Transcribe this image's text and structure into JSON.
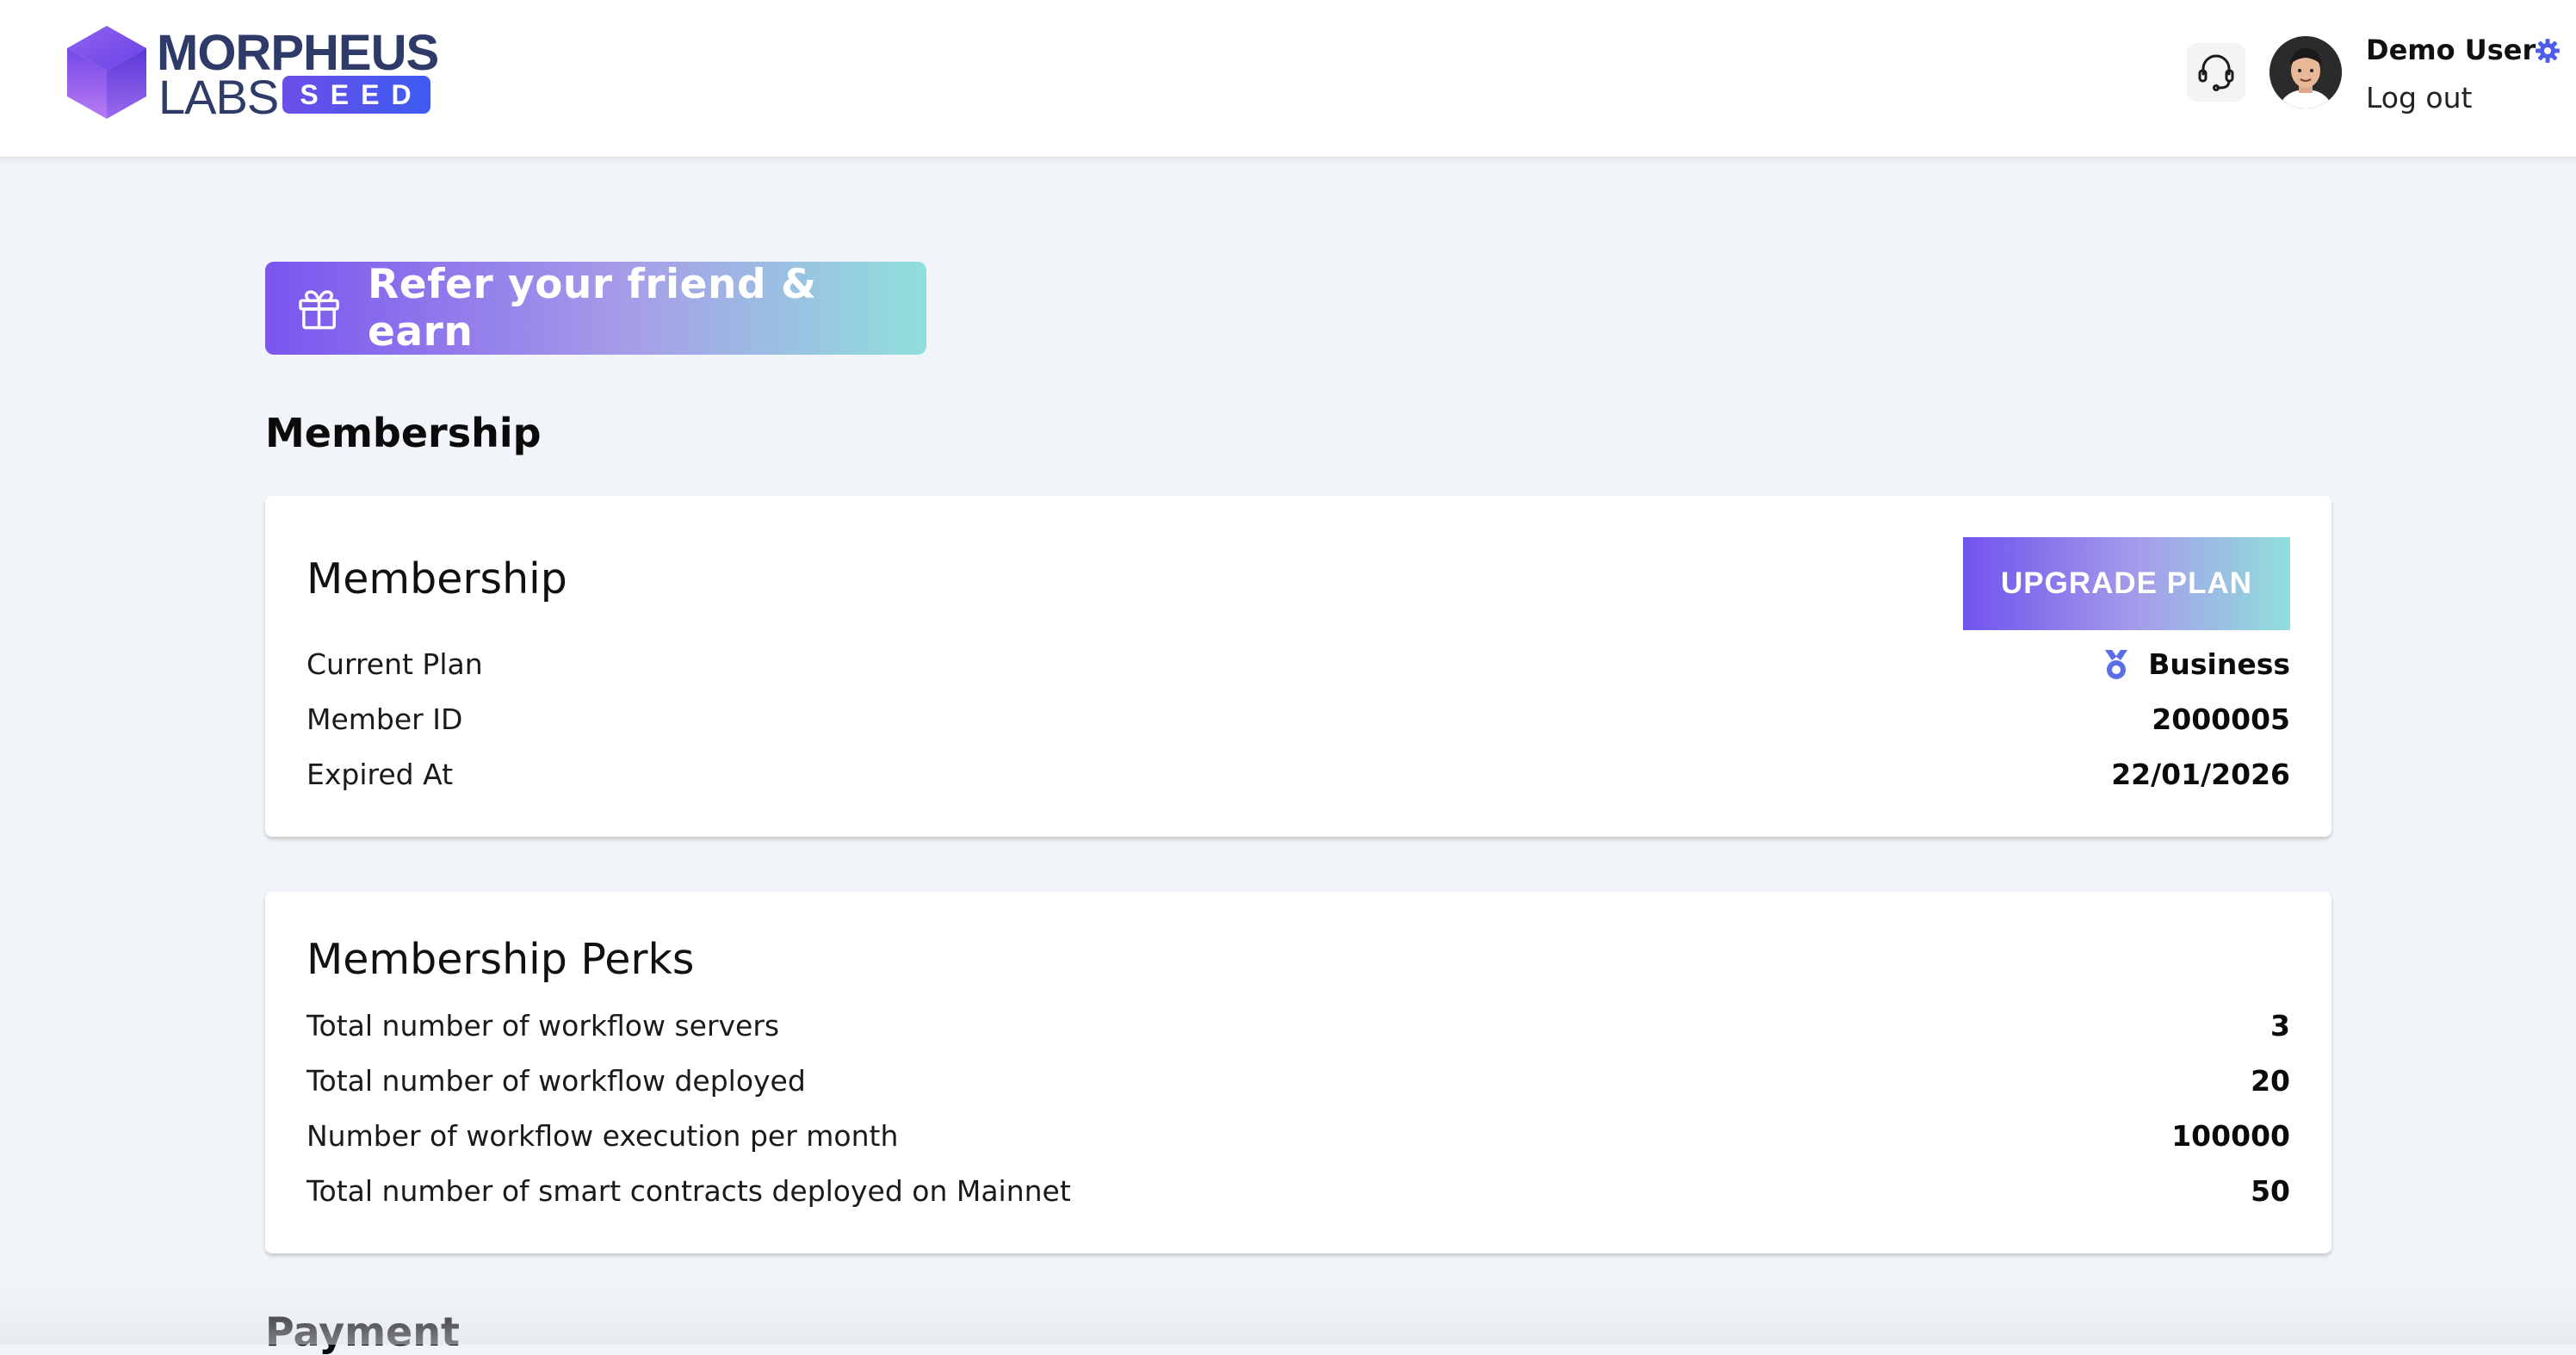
{
  "brand": {
    "word1": "MORPHEUS",
    "word2": "LABS",
    "badge": "SEED",
    "primary_color": "#2e3a67",
    "accent_color": "#6c4fe8"
  },
  "header": {
    "support_icon": "headset-icon",
    "user_name": "Demo User",
    "settings_icon": "gear-icon",
    "logout_label": "Log out"
  },
  "referral": {
    "icon": "gift-icon",
    "label": "Refer your friend & earn"
  },
  "sections": {
    "membership_heading": "Membership",
    "payment_heading": "Payment"
  },
  "membership_card": {
    "title": "Membership",
    "upgrade_label": "UPGRADE PLAN",
    "rows": [
      {
        "label": "Current Plan",
        "value": "Business",
        "icon": "medal-icon"
      },
      {
        "label": "Member ID",
        "value": "2000005"
      },
      {
        "label": "Expired At",
        "value": "22/01/2026"
      }
    ]
  },
  "perks_card": {
    "title": "Membership Perks",
    "rows": [
      {
        "label": "Total number of workflow servers",
        "value": "3"
      },
      {
        "label": "Total number of workflow deployed",
        "value": "20"
      },
      {
        "label": "Number of workflow execution per month",
        "value": "100000"
      },
      {
        "label": "Total number of smart contracts deployed on Mainnet",
        "value": "50"
      }
    ]
  }
}
